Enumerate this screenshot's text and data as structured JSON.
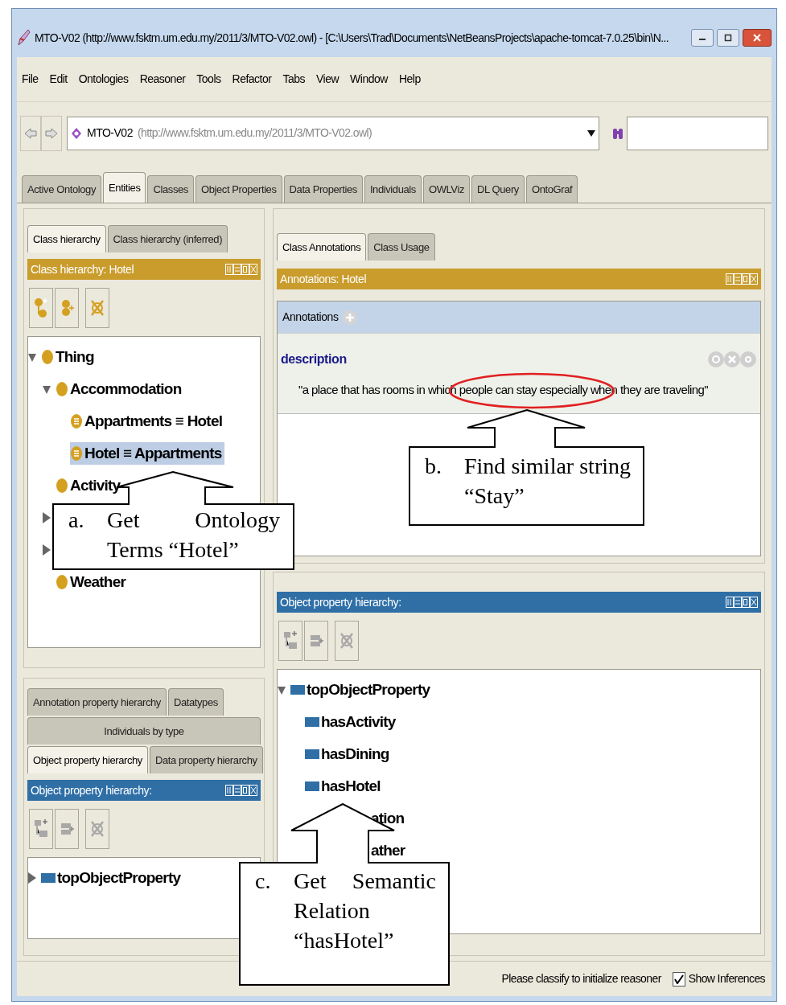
{
  "window": {
    "title": "MTO-V02 (http://www.fsktm.um.edu.my/2011/3/MTO-V02.owl) - [C:\\Users\\Trad\\Documents\\NetBeansProjects\\apache-tomcat-7.0.25\\bin\\N..."
  },
  "menu": [
    "File",
    "Edit",
    "Ontologies",
    "Reasoner",
    "Tools",
    "Refactor",
    "Tabs",
    "View",
    "Window",
    "Help"
  ],
  "address": {
    "name": "MTO-V02",
    "iri": "(http://www.fsktm.um.edu.my/2011/3/MTO-V02.owl)"
  },
  "tabs": [
    {
      "label": "Active Ontology",
      "selected": false
    },
    {
      "label": "Entities",
      "selected": true
    },
    {
      "label": "Classes",
      "selected": false
    },
    {
      "label": "Object Properties",
      "selected": false
    },
    {
      "label": "Data Properties",
      "selected": false
    },
    {
      "label": "Individuals",
      "selected": false
    },
    {
      "label": "OWLViz",
      "selected": false
    },
    {
      "label": "DL Query",
      "selected": false
    },
    {
      "label": "OntoGraf",
      "selected": false
    }
  ],
  "class_panel": {
    "tabs": [
      {
        "label": "Class hierarchy",
        "selected": true
      },
      {
        "label": "Class hierarchy (inferred)",
        "selected": false
      }
    ],
    "header": "Class hierarchy: Hotel",
    "tree": [
      {
        "label": "Thing",
        "kind": "class",
        "expanded": true,
        "selected": false,
        "children": [
          {
            "label": "Accommodation",
            "kind": "class",
            "expanded": true,
            "selected": false,
            "children": [
              {
                "label": "Appartments ≡ Hotel",
                "kind": "defined",
                "selected": false
              },
              {
                "label": "Hotel ≡ Appartments",
                "kind": "defined",
                "selected": true
              }
            ]
          },
          {
            "label": "Activity",
            "kind": "class",
            "selected": false
          },
          {
            "kind": "class",
            "expanded": false
          },
          {
            "kind": "class",
            "expanded": false
          },
          {
            "label": "Weather",
            "kind": "class",
            "selected": false
          }
        ]
      }
    ]
  },
  "annotation_panel": {
    "tabs": [
      {
        "label": "Class Annotations",
        "selected": true
      },
      {
        "label": "Class Usage",
        "selected": false
      }
    ],
    "header": "Annotations: Hotel",
    "section": "Annotations",
    "property": "description",
    "value": "\"a place that has rooms in which people can stay especially when they are traveling\""
  },
  "property_panel": {
    "header": "Object property hierarchy:",
    "tree": [
      {
        "label": "topObjectProperty",
        "kind": "property",
        "expanded": true,
        "children": [
          {
            "label": "hasActivity",
            "kind": "property"
          },
          {
            "label": "hasDining",
            "kind": "property"
          },
          {
            "label": "hasHotel",
            "kind": "property"
          },
          {
            "label": "ation",
            "kind": "clipped"
          },
          {
            "label": "ather",
            "kind": "clipped"
          }
        ]
      }
    ]
  },
  "bottom_left_panel": {
    "tab_rows": [
      [
        {
          "label": "Annotation property hierarchy",
          "selected": false
        },
        {
          "label": "Datatypes",
          "selected": false
        }
      ],
      [
        {
          "label": "Individuals by type",
          "selected": false
        }
      ],
      [
        {
          "label": "Object property hierarchy",
          "selected": true
        },
        {
          "label": "Data property hierarchy",
          "selected": false
        }
      ]
    ],
    "header": "Object property hierarchy:",
    "tree": [
      {
        "label": "topObjectProperty",
        "kind": "property",
        "expanded": false
      }
    ]
  },
  "status_bar": {
    "message": "Please classify to initialize reasoner",
    "show_inferences": {
      "label": "Show Inferences",
      "checked": true
    }
  },
  "callouts": [
    {
      "marker": "a.",
      "text": "Get Ontology Terms “Hotel”"
    },
    {
      "marker": "b.",
      "text": "Find similar string “Stay”"
    },
    {
      "marker": "c.",
      "text": "Get Semantic Relation “hasHotel”"
    }
  ]
}
